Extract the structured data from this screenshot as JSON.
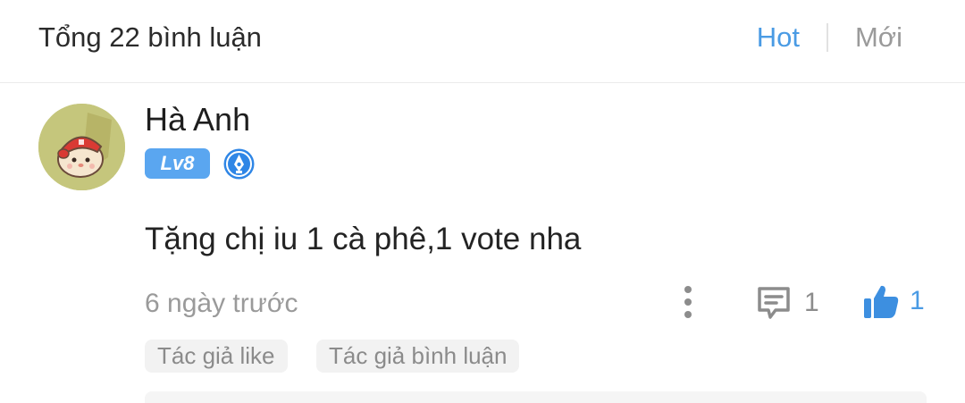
{
  "header": {
    "title": "Tổng 22 bình luận",
    "sort_hot": "Hot",
    "sort_new": "Mới"
  },
  "comment": {
    "username": "Hà Anh",
    "level": "Lv8",
    "text": "Tặng chị iu 1 cà phê,1 vote nha",
    "time": "6 ngày trước",
    "reply_count": "1",
    "like_count": "1",
    "tags": [
      "Tác giả like",
      "Tác giả bình luận"
    ]
  },
  "colors": {
    "accent": "#4a9be4",
    "level_badge": "#5aa6f0",
    "muted_text": "#9a9a9a"
  },
  "icons": {
    "avatar": "cartoon-hamster-avatar",
    "author_badge": "pen-icon",
    "more": "more-vertical-icon",
    "reply": "comment-icon",
    "like": "thumbs-up-icon"
  }
}
